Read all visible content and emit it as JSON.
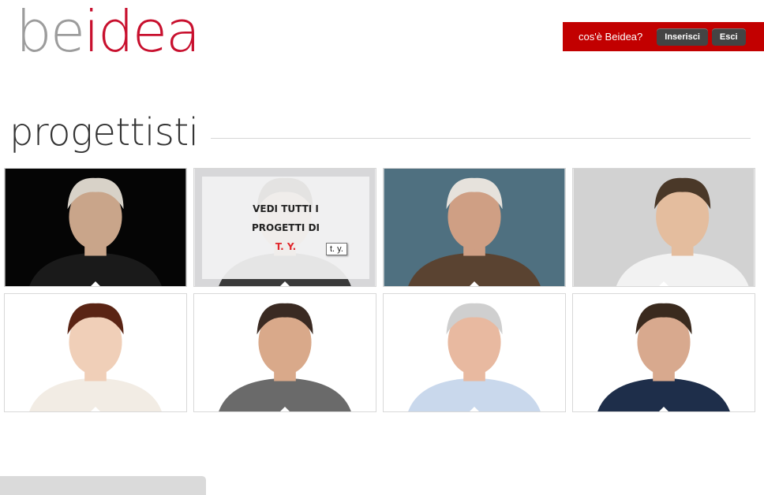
{
  "brand": {
    "part1": "be",
    "part2": "idea"
  },
  "topbar": {
    "about_label": "cos'è Beidea?",
    "login_label": "Inserisci",
    "logout_label": "Esci"
  },
  "section": {
    "title": "progettisti"
  },
  "overlay": {
    "line1": "VEDI TUTTI I",
    "line2": "PROGETTI DI",
    "name": "T. Y."
  },
  "tooltip": {
    "text": "t. y."
  },
  "colors": {
    "brand_red": "#c8102e",
    "bar_red": "#c20000",
    "button_gray": "#444444"
  },
  "cards": [
    {
      "name": "designer-1",
      "bg": "#050505",
      "skin": "#c9a58a",
      "hair": "#d8d2c8",
      "shirt": "#1a1a1a"
    },
    {
      "name": "designer-2",
      "bg": "#d7d7d9",
      "skin": "#d6ac8e",
      "hair": "#2b1d14",
      "shirt": "#3a3a3a"
    },
    {
      "name": "designer-3",
      "bg": "#4f7080",
      "skin": "#cf9f84",
      "hair": "#e6e2dc",
      "shirt": "#5a4331"
    },
    {
      "name": "designer-4",
      "bg": "#d2d2d2",
      "skin": "#e4bd9e",
      "hair": "#4a3828",
      "shirt": "#f2f2f2"
    },
    {
      "name": "designer-5",
      "bg": "#ffffff",
      "skin": "#f0cfb8",
      "hair": "#5a2414",
      "shirt": "#f2ece4"
    },
    {
      "name": "designer-6",
      "bg": "#ffffff",
      "skin": "#d9a98a",
      "hair": "#3a2a22",
      "shirt": "#6a6a6a"
    },
    {
      "name": "designer-7",
      "bg": "#ffffff",
      "skin": "#e8b9a0",
      "hair": "#cfcfcf",
      "shirt": "#c9d8ec"
    },
    {
      "name": "designer-8",
      "bg": "#ffffff",
      "skin": "#d8a98e",
      "hair": "#3a2a1e",
      "shirt": "#1e2e4a"
    }
  ]
}
